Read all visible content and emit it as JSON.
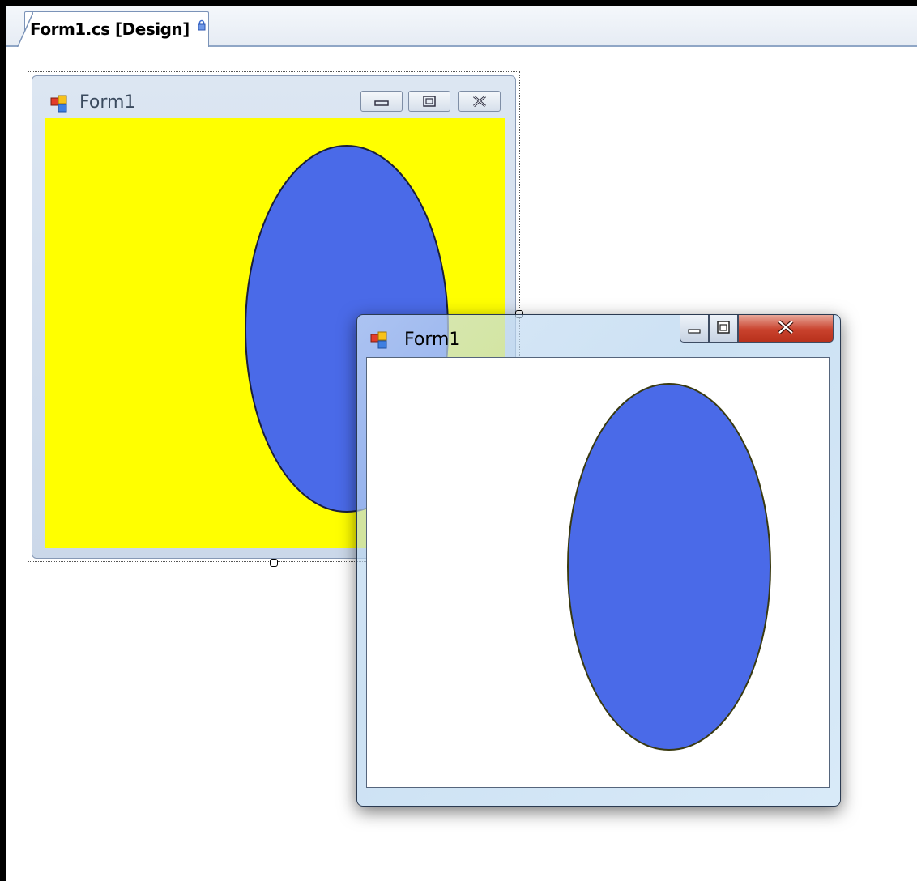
{
  "document_tab": {
    "title": "Form1.cs [Design]",
    "icon": "lock-icon"
  },
  "design_form": {
    "title": "Form1",
    "icon": "form-icon",
    "back_color": "#ffff00",
    "ellipse_color": "#4a6ae8",
    "buttons": [
      "minimize-icon",
      "maximize-icon",
      "close-icon"
    ]
  },
  "runtime_form": {
    "title": "Form1",
    "icon": "form-icon",
    "back_color": "#ffffff",
    "ellipse_color": "#4a6ae8",
    "buttons": [
      "minimize-icon",
      "maximize-icon",
      "close-icon"
    ]
  }
}
